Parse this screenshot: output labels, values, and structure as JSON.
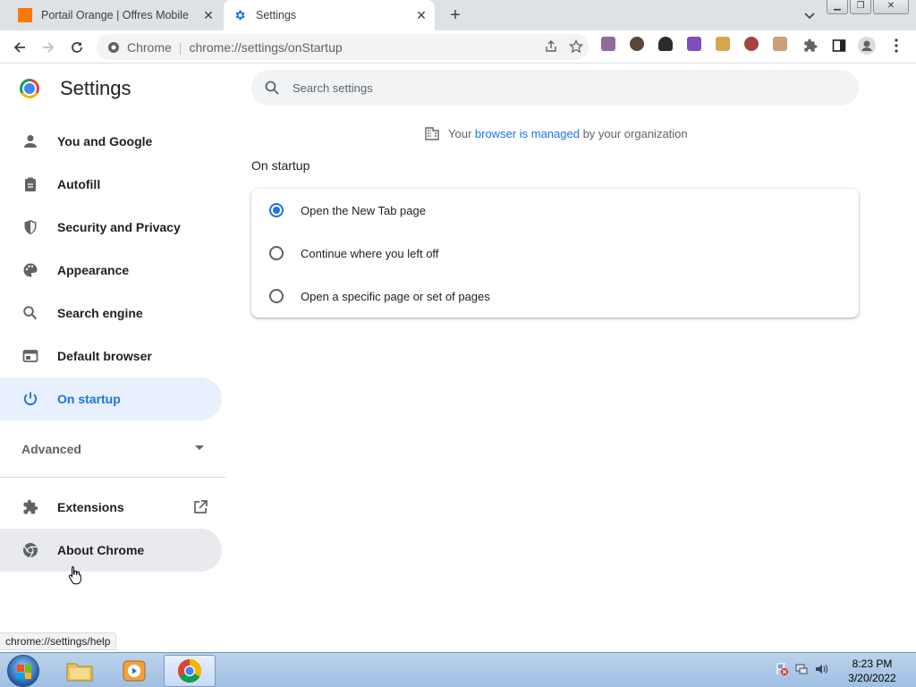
{
  "browser": {
    "tabs": [
      {
        "label": "Portail Orange | Offres Mobiles, I",
        "active": false
      },
      {
        "label": "Settings",
        "active": true
      }
    ],
    "omnibox": {
      "site": "Chrome",
      "url": "chrome://settings/onStartup"
    },
    "extensions": [
      "avatar-ext-1",
      "face-ext-2",
      "hat-ext-3",
      "sparkle-ext-4",
      "doge-ext-5",
      "face-ext-6",
      "cake-ext-7"
    ]
  },
  "settings": {
    "title": "Settings",
    "search_placeholder": "Search settings",
    "sidebar": [
      {
        "label": "You and Google",
        "icon": "person-icon"
      },
      {
        "label": "Autofill",
        "icon": "clipboard-icon"
      },
      {
        "label": "Security and Privacy",
        "icon": "shield-icon"
      },
      {
        "label": "Appearance",
        "icon": "palette-icon"
      },
      {
        "label": "Search engine",
        "icon": "search-icon"
      },
      {
        "label": "Default browser",
        "icon": "browser-icon"
      },
      {
        "label": "On startup",
        "icon": "power-icon",
        "active": true
      }
    ],
    "advanced_label": "Advanced",
    "bottom_items": [
      {
        "label": "Extensions",
        "icon": "puzzle-icon"
      },
      {
        "label": "About Chrome",
        "icon": "chrome-icon"
      }
    ],
    "managed": {
      "prefix": "Your ",
      "link": "browser is managed",
      "suffix": " by your organization"
    },
    "section_title": "On startup",
    "startup_options": [
      {
        "label": "Open the New Tab page",
        "checked": true
      },
      {
        "label": "Continue where you left off",
        "checked": false
      },
      {
        "label": "Open a specific page or set of pages",
        "checked": false
      }
    ]
  },
  "status_url": "chrome://settings/help",
  "taskbar": {
    "time": "8:23 PM",
    "date": "3/20/2022"
  },
  "colors": {
    "accent": "#1a73e8",
    "active_bg": "#e8f0fe"
  }
}
